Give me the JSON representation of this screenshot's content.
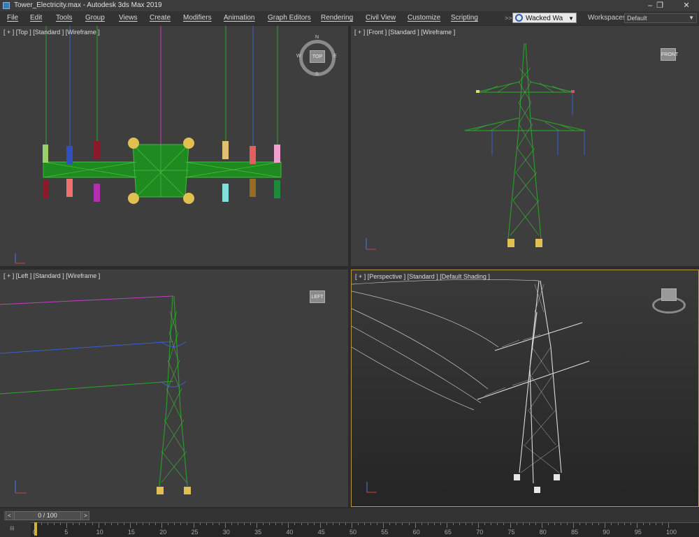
{
  "window": {
    "title": "Tower_Electricity.max - Autodesk 3ds Max 2019",
    "minimize": "–",
    "maximize": "❐",
    "close": "✕"
  },
  "menu": [
    "File",
    "Edit",
    "Tools",
    "Group",
    "Views",
    "Create",
    "Modifiers",
    "Animation",
    "Graph Editors",
    "Rendering",
    "Civil View",
    "Customize",
    "Scripting"
  ],
  "user": {
    "name": "Wacked Wa",
    "icon": "user-icon"
  },
  "workspaces": {
    "label": "Workspaces:",
    "value": "Default"
  },
  "viewports": {
    "top": {
      "label": "[ + ] [Top ] [Standard ] [Wireframe ]",
      "cube": "TOP"
    },
    "front": {
      "label": "[ + ] [Front ] [Standard ] [Wireframe ]",
      "cube": "FRONT"
    },
    "left": {
      "label": "[ + ] [Left ] [Standard ] [Wireframe ]",
      "cube": "LEFT"
    },
    "persp": {
      "label": "[ + ] [Perspective ] [Standard ] [Default Shading ]"
    }
  },
  "compass": {
    "n": "N",
    "s": "S",
    "e": "E",
    "w": "W"
  },
  "timeline": {
    "frame": "0 / 100",
    "prev": "<",
    "next": ">",
    "ticks": [
      "0",
      "5",
      "10",
      "15",
      "20",
      "25",
      "30",
      "35",
      "40",
      "45",
      "50",
      "55",
      "60",
      "65",
      "70",
      "75",
      "80",
      "85",
      "90",
      "95",
      "100"
    ]
  },
  "colors": {
    "tower": "#1f8a1f",
    "persp_tower": "#d8d8d8",
    "active_border": "#b9993b"
  }
}
